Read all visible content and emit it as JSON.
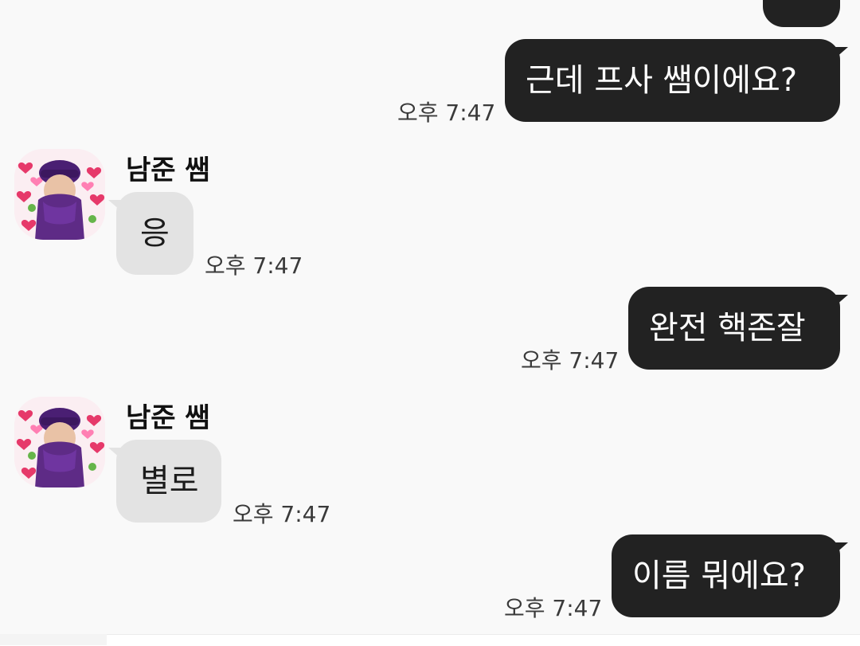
{
  "colors": {
    "background": "#f9f9f9",
    "outgoing_bubble": "#222222",
    "incoming_bubble": "#e3e3e3",
    "avatar_purple": "#5e2b86"
  },
  "messages": [
    {
      "direction": "out",
      "text": "",
      "time": ""
    },
    {
      "direction": "out",
      "text": "근데 프사 쌤이에요?",
      "time": "오후 7:47"
    },
    {
      "direction": "in",
      "sender": "남준 쌤",
      "text": "응",
      "time": "오후 7:47"
    },
    {
      "direction": "out",
      "text": "완전 핵존잘",
      "time": "오후 7:47"
    },
    {
      "direction": "in",
      "sender": "남준 쌤",
      "text": "별로",
      "time": "오후 7:47"
    },
    {
      "direction": "out",
      "text": "이름 뭐에요?",
      "time": "오후 7:47"
    }
  ],
  "avatar": {
    "icon": "profile-avatar-icon",
    "decorations": "heart emojis"
  }
}
